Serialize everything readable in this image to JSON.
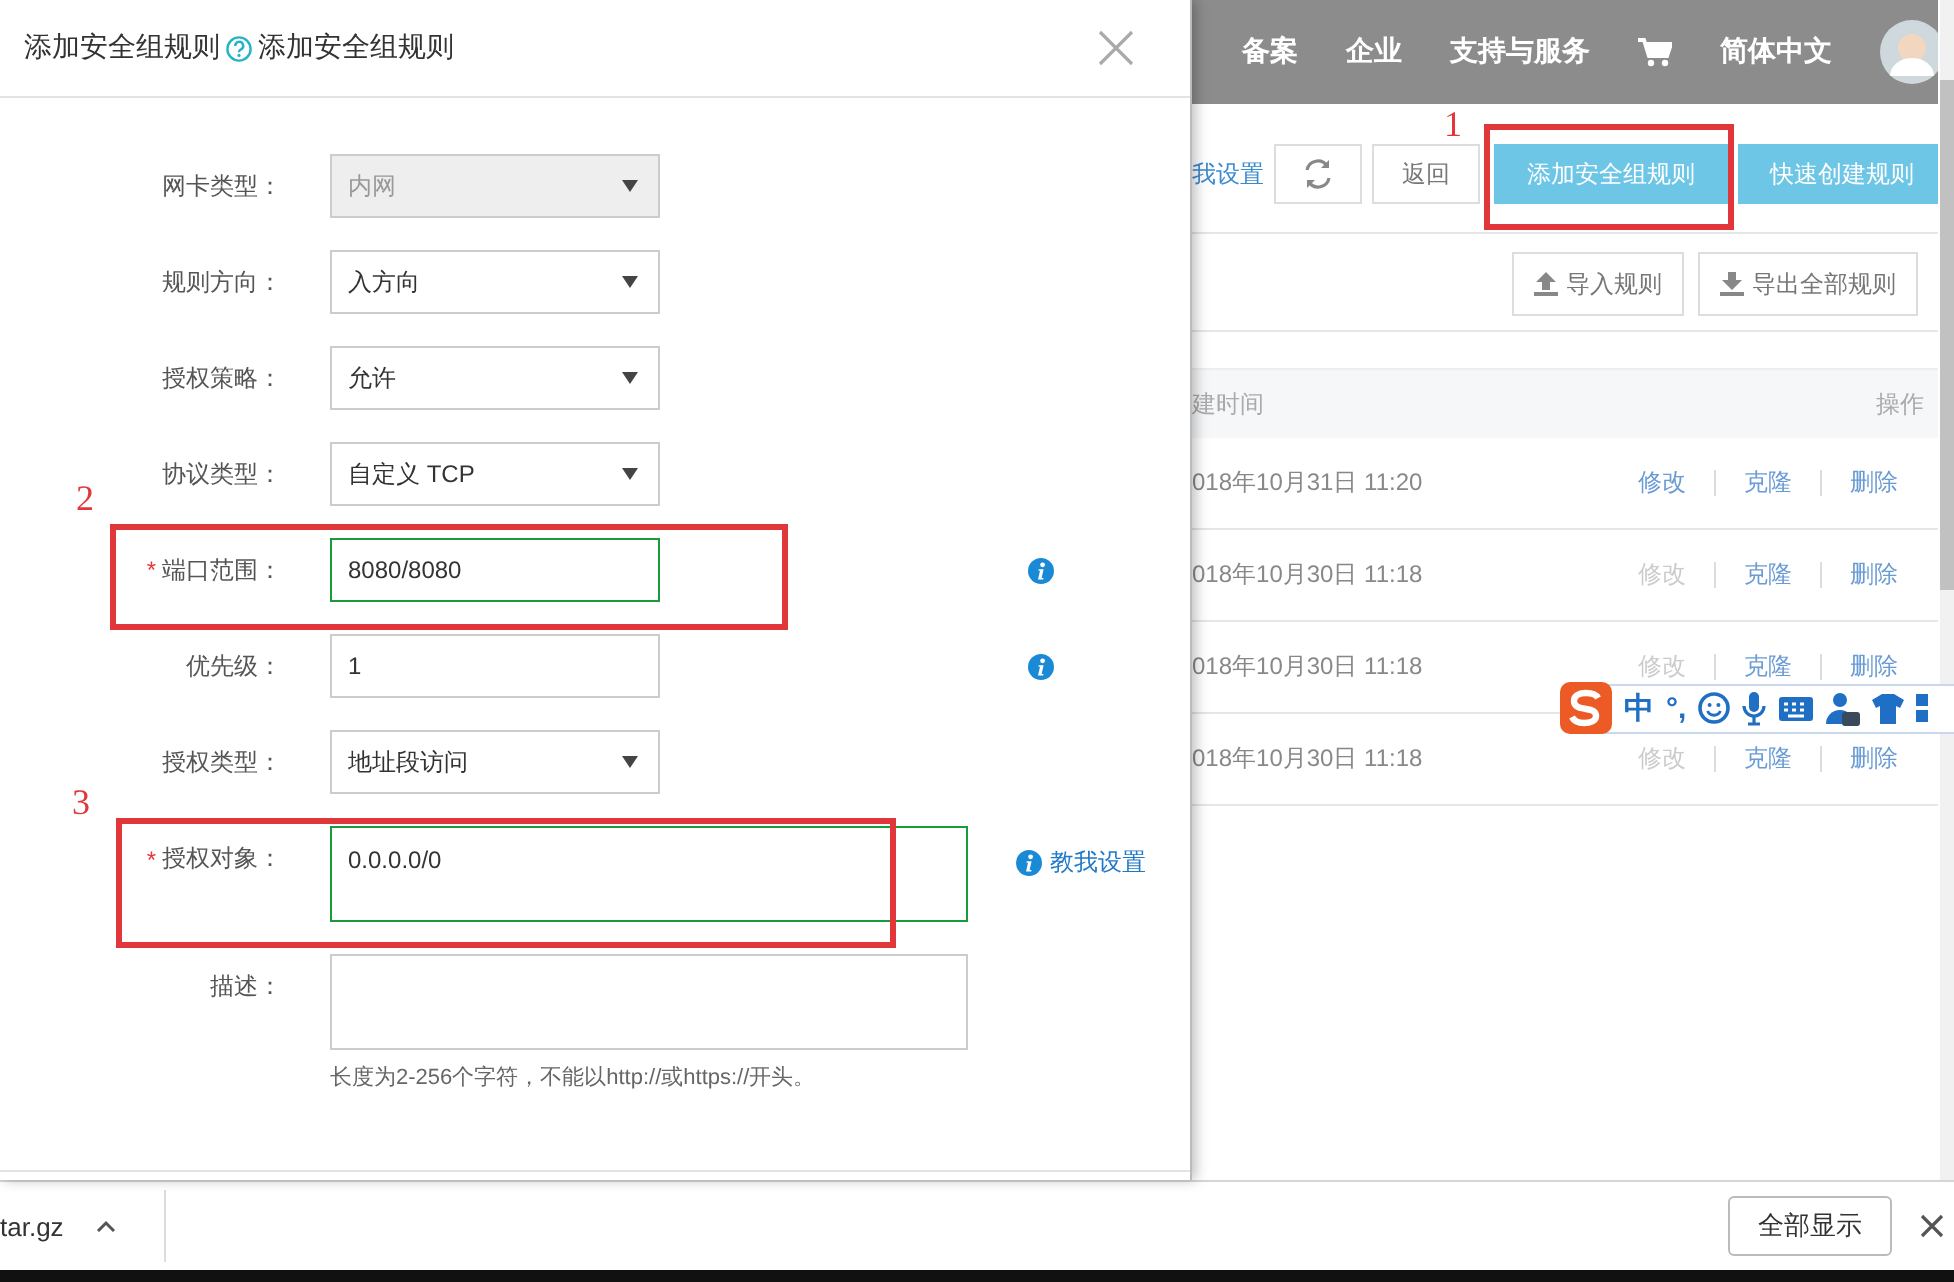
{
  "dialog": {
    "title": "添加安全组规则",
    "help_text": "添加安全组规则",
    "fields": [
      {
        "kind": "select",
        "label": "网卡类型：",
        "value": "内网",
        "disabled": true,
        "required": false,
        "valid": false,
        "info": false
      },
      {
        "kind": "select",
        "label": "规则方向：",
        "value": "入方向",
        "disabled": false,
        "required": false,
        "valid": false,
        "info": false
      },
      {
        "kind": "select",
        "label": "授权策略：",
        "value": "允许",
        "disabled": false,
        "required": false,
        "valid": false,
        "info": false
      },
      {
        "kind": "select",
        "label": "协议类型：",
        "value": "自定义 TCP",
        "disabled": false,
        "required": false,
        "valid": false,
        "info": false
      },
      {
        "kind": "input",
        "label": "端口范围：",
        "value": "8080/8080",
        "disabled": false,
        "required": true,
        "required_mark": "*",
        "valid": true,
        "info": true
      },
      {
        "kind": "input",
        "label": "优先级：",
        "value": "1",
        "disabled": false,
        "required": false,
        "valid": false,
        "info": true
      },
      {
        "kind": "select",
        "label": "授权类型：",
        "value": "地址段访问",
        "disabled": false,
        "required": false,
        "valid": false,
        "info": false
      },
      {
        "kind": "textarea",
        "label": "授权对象：",
        "value": "0.0.0.0/0",
        "disabled": false,
        "required": true,
        "required_mark": "*",
        "valid": true,
        "info": false,
        "link": "教我设置"
      },
      {
        "kind": "textarea",
        "label": "描述：",
        "disabled": false,
        "required": false,
        "valid": false,
        "info": false,
        "hint": "长度为2-256个字符，不能以http://或https://开头。"
      }
    ]
  },
  "top_nav": [
    {
      "kind": "link",
      "label": "备案"
    },
    {
      "kind": "link",
      "label": "企业"
    },
    {
      "kind": "link",
      "label": "支持与服务"
    },
    {
      "kind": "cart"
    },
    {
      "kind": "link",
      "label": "简体中文"
    },
    {
      "kind": "avatar"
    }
  ],
  "toolbar": {
    "link": "我设置",
    "buttons": [
      {
        "kind": "refresh"
      },
      {
        "kind": "plain",
        "label": "返回"
      },
      {
        "kind": "primary",
        "label": "添加安全组规则"
      },
      {
        "kind": "primary",
        "label": "快速创建规则"
      }
    ]
  },
  "actions": [
    {
      "kind": "import",
      "label": "导入规则"
    },
    {
      "kind": "export",
      "label": "导出全部规则"
    }
  ],
  "table": {
    "columns": [
      "建时间",
      "操作"
    ],
    "rows": [
      {
        "created": "018年10月31日 11:20",
        "actions": [
          {
            "label": "修改",
            "disabled": false
          },
          {
            "label": "克隆",
            "disabled": false
          },
          {
            "label": "删除",
            "disabled": false
          }
        ]
      },
      {
        "created": "018年10月30日 11:18",
        "actions": [
          {
            "label": "修改",
            "disabled": true
          },
          {
            "label": "克隆",
            "disabled": false
          },
          {
            "label": "删除",
            "disabled": false
          }
        ]
      },
      {
        "created": "018年10月30日 11:18",
        "actions": [
          {
            "label": "修改",
            "disabled": true
          },
          {
            "label": "克隆",
            "disabled": false
          },
          {
            "label": "删除",
            "disabled": false
          }
        ]
      },
      {
        "created": "018年10月30日 11:18",
        "actions": [
          {
            "label": "修改",
            "disabled": true
          },
          {
            "label": "克隆",
            "disabled": false
          },
          {
            "label": "删除",
            "disabled": false
          }
        ]
      }
    ]
  },
  "ime_toolbar": {
    "mode": "中",
    "punctuation": "°,"
  },
  "annotations": [
    {
      "number": "1"
    },
    {
      "number": "2"
    },
    {
      "number": "3"
    }
  ],
  "download_bar": {
    "file": "tar.gz",
    "show_all": "全部显示"
  }
}
